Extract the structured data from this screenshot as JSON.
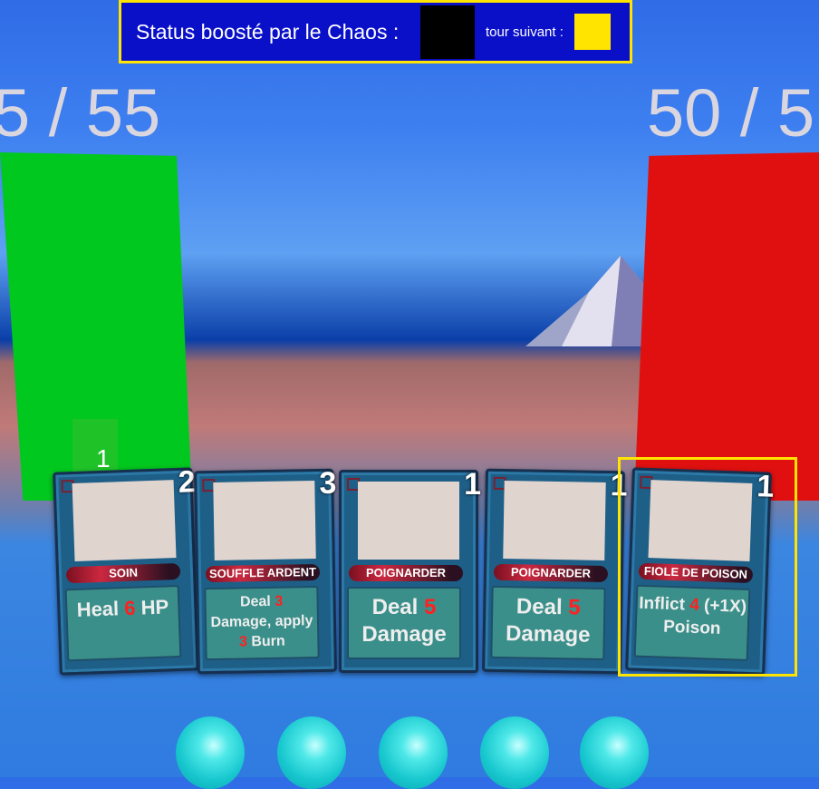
{
  "status": {
    "chaos_label": "Status boosté par le Chaos :",
    "next_label": "tour suivant :",
    "next_color": "#ffe400",
    "current_color": "#000000"
  },
  "player_hp": {
    "text": "5 / 55",
    "bar_color": "#00c81e"
  },
  "enemy_hp": {
    "text": "50 / 5",
    "bar_color": "#e01010"
  },
  "marker_number": "1",
  "cards": [
    {
      "cost": "2",
      "name": "SOIN",
      "desc": [
        [
          "Heal ",
          "6",
          " HP"
        ]
      ]
    },
    {
      "cost": "3",
      "name": "SOUFFLE ARDENT",
      "desc": [
        [
          "Deal ",
          "3",
          ""
        ],
        [
          "Damage, apply",
          "",
          ""
        ],
        [
          "",
          "3",
          " Burn"
        ]
      ]
    },
    {
      "cost": "1",
      "name": "POIGNARDER",
      "desc": [
        [
          "Deal ",
          "5",
          ""
        ],
        [
          "Damage",
          "",
          ""
        ]
      ]
    },
    {
      "cost": "1",
      "name": "POIGNARDER",
      "desc": [
        [
          "Deal ",
          "5",
          ""
        ],
        [
          "Damage",
          "",
          ""
        ]
      ]
    },
    {
      "cost": "1",
      "name": "FIOLE DE POISON",
      "desc": [
        [
          "Inflict ",
          "4",
          " (+1X)"
        ],
        [
          "Poison",
          "",
          ""
        ]
      ]
    }
  ],
  "energy_orbs": 5
}
